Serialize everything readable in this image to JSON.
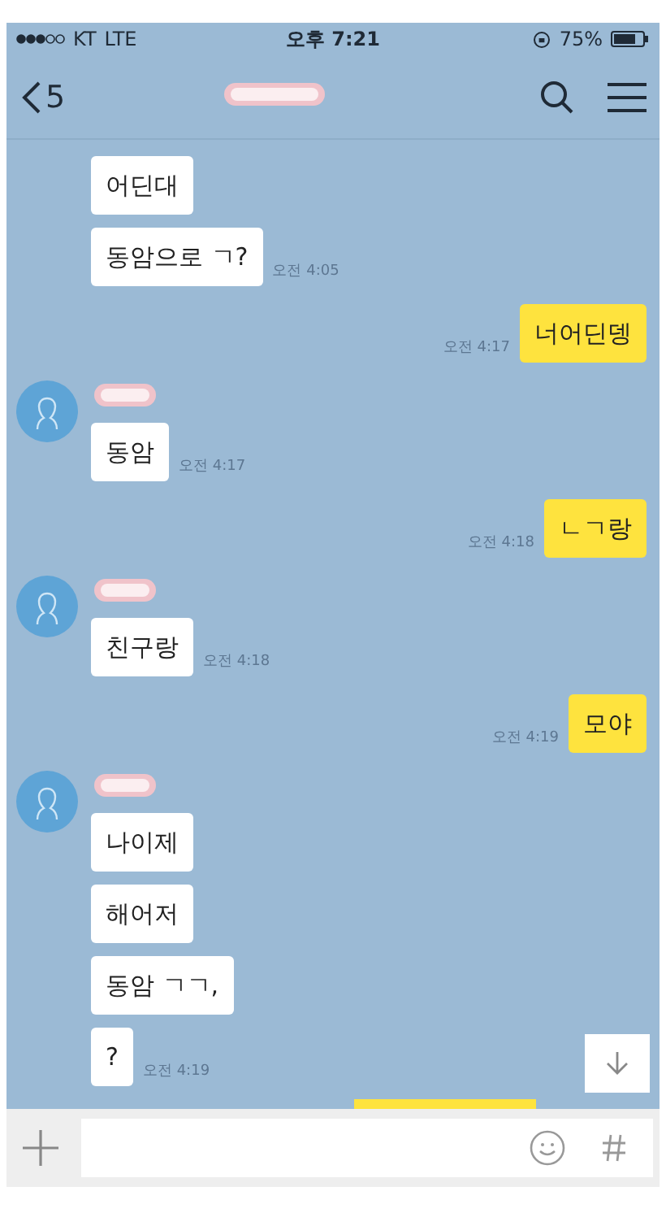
{
  "status_bar": {
    "carrier": "KT",
    "network": "LTE",
    "time": "오후 7:21",
    "battery": "75%"
  },
  "header": {
    "back_count": "5"
  },
  "messages": [
    {
      "kind": "incoming",
      "avatar": false,
      "bubbles": [
        "어딘대",
        "동암으로 ㄱ?"
      ],
      "time": "오전 4:05"
    },
    {
      "kind": "outgoing",
      "bubbles": [
        "너어딘뎅"
      ],
      "time": "오전 4:17"
    },
    {
      "kind": "incoming",
      "avatar": true,
      "bubbles": [
        "동암"
      ],
      "time": "오전 4:17"
    },
    {
      "kind": "outgoing",
      "bubbles": [
        "ㄴㄱ랑"
      ],
      "time": "오전 4:18"
    },
    {
      "kind": "incoming",
      "avatar": true,
      "bubbles": [
        "친구랑"
      ],
      "time": "오전 4:18"
    },
    {
      "kind": "outgoing",
      "bubbles": [
        "모야"
      ],
      "time": "오전 4:19"
    },
    {
      "kind": "incoming",
      "avatar": true,
      "bubbles": [
        "나이제",
        "해어저",
        "동암 ㄱㄱ,",
        "?"
      ],
      "time": "오전 4:19"
    }
  ]
}
